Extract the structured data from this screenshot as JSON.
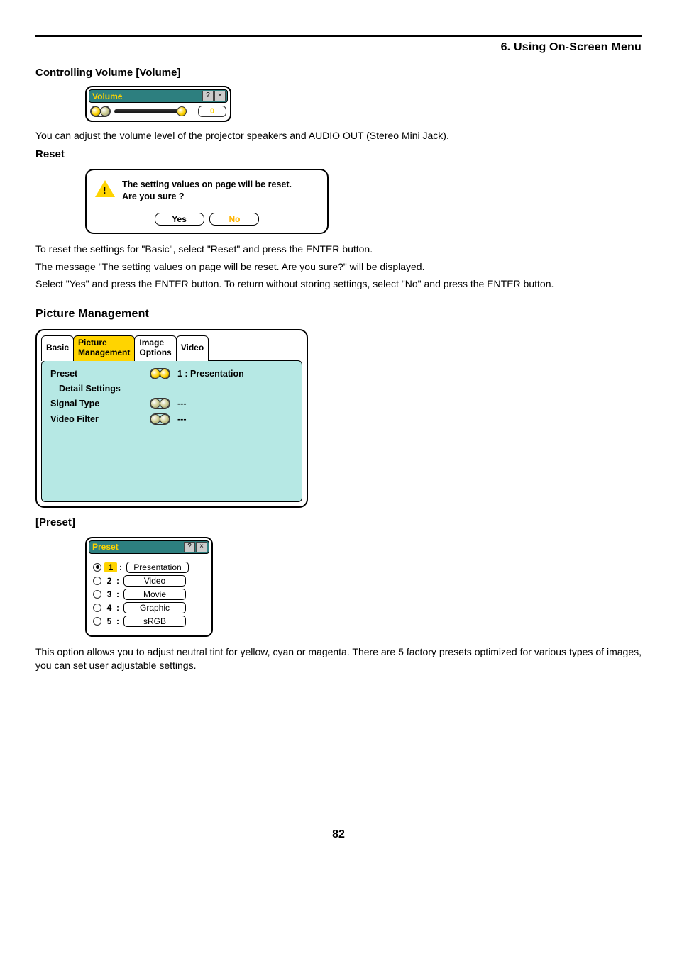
{
  "chapter": "6. Using On-Screen Menu",
  "page_number": "82",
  "sections": {
    "volume": {
      "heading": "Controlling Volume [Volume]",
      "widget_title": "Volume",
      "value": "0",
      "desc": "You can adjust the volume level of the projector speakers and AUDIO OUT (Stereo Mini Jack)."
    },
    "reset": {
      "heading": "Reset",
      "dialog_line1": "The setting values on page will be reset.",
      "dialog_line2": "Are you sure ?",
      "yes": "Yes",
      "no": "No",
      "body1": "To reset the settings for \"Basic\", select \"Reset\" and press the ENTER button.",
      "body2": "The message \"The setting values on page will be reset. Are you sure?\" will be displayed.",
      "body3": "Select \"Yes\" and press the ENTER button. To return without storing settings, select \"No\" and press the ENTER button."
    },
    "pm": {
      "heading": "Picture Management",
      "tabs": {
        "basic": "Basic",
        "pm1": "Picture",
        "pm2": "Management",
        "io1": "Image",
        "io2": "Options",
        "video": "Video"
      },
      "rows": {
        "preset_label": "Preset",
        "preset_value": "1 : Presentation",
        "detail": "Detail Settings",
        "signal_label": "Signal Type",
        "signal_value": "---",
        "filter_label": "Video Filter",
        "filter_value": "---"
      }
    },
    "preset": {
      "heading": "[Preset]",
      "widget_title": "Preset",
      "items": [
        {
          "num": "1",
          "label": "Presentation",
          "selected": true
        },
        {
          "num": "2",
          "label": "Video",
          "selected": false
        },
        {
          "num": "3",
          "label": "Movie",
          "selected": false
        },
        {
          "num": "4",
          "label": "Graphic",
          "selected": false
        },
        {
          "num": "5",
          "label": "sRGB",
          "selected": false
        }
      ],
      "desc": "This option allows you to adjust neutral tint for yellow, cyan or magenta. There are 5 factory presets optimized for various types of images, you can set user adjustable settings."
    }
  }
}
